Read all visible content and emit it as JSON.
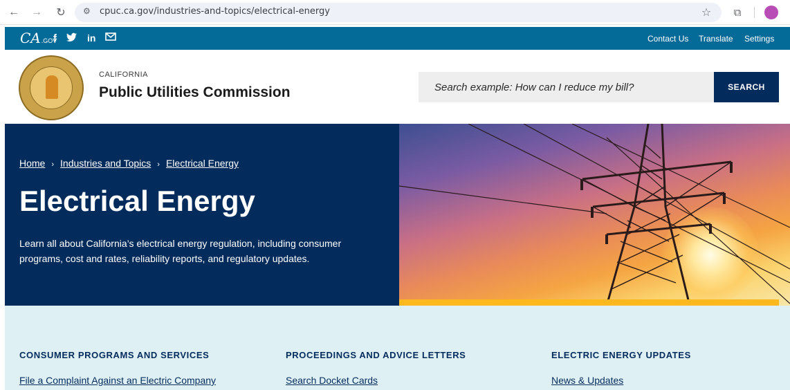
{
  "browser": {
    "url": "cpuc.ca.gov/industries-and-topics/electrical-energy"
  },
  "utility": {
    "logo_main": "CA",
    "logo_suffix": ".GOV",
    "links": [
      "Contact Us",
      "Translate",
      "Settings"
    ]
  },
  "header": {
    "agency_small": "CALIFORNIA",
    "agency_name": "Public Utilities Commission",
    "search_placeholder": "Search example: How can I reduce my bill?",
    "search_button": "SEARCH"
  },
  "hero": {
    "breadcrumb": [
      "Home",
      "Industries and Topics",
      "Electrical Energy"
    ],
    "breadcrumb_sep": "›",
    "title": "Electrical Energy",
    "description": "Learn all about California’s electrical energy regulation, including consumer programs, cost and rates, reliability reports, and regulatory updates."
  },
  "columns": [
    {
      "heading": "CONSUMER PROGRAMS AND SERVICES",
      "link": "File a Complaint Against an Electric Company"
    },
    {
      "heading": "PROCEEDINGS AND ADVICE LETTERS",
      "link": "Search Docket Cards"
    },
    {
      "heading": "ELECTRIC ENERGY UPDATES",
      "link": "News & Updates"
    }
  ],
  "colors": {
    "utility_bar": "#046b99",
    "navy": "#032c5c",
    "gold": "#fdb81e",
    "light_section": "#dff0f5"
  }
}
